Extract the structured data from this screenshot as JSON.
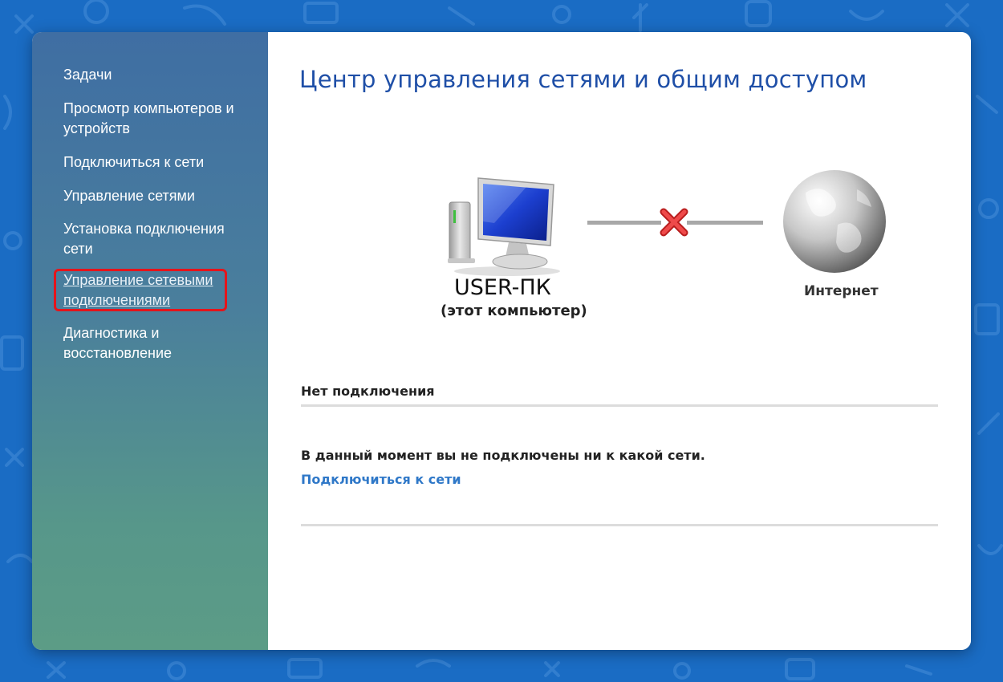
{
  "sidebar": {
    "title": "Задачи",
    "items": [
      {
        "label": "Просмотр компьютеров и устройств"
      },
      {
        "label": "Подключиться к сети"
      },
      {
        "label": "Управление сетями"
      },
      {
        "label": "Установка подключения сети"
      },
      {
        "label": "Управление сетевыми подключениями",
        "active": true
      },
      {
        "label": "Диагностика и восстановление"
      }
    ]
  },
  "main": {
    "title": "Центр управления сетями и общим доступом",
    "computer": {
      "name": "USER-ПК",
      "subtitle": "(этот компьютер)",
      "icon": "computer-icon"
    },
    "internet": {
      "label": "Интернет",
      "icon": "globe-icon"
    },
    "connection_status_icon": "x-mark-icon",
    "section_title": "Нет подключения",
    "status_text": "В данный момент вы не подключены ни к какой сети.",
    "connect_link": "Подключиться к сети"
  },
  "colors": {
    "background": "#1a6cc4",
    "title": "#1f4fa7",
    "link": "#2f78c8",
    "highlight": "#e5141b"
  }
}
